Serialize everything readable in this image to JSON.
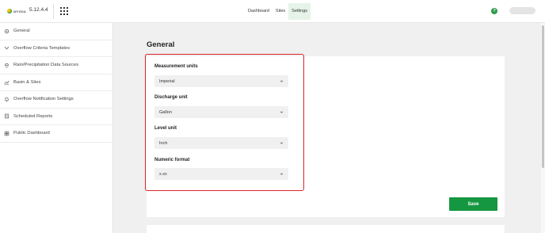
{
  "app": {
    "logo_text": "WYSDA",
    "version": "5.12.4.4"
  },
  "nav": {
    "items": [
      {
        "label": "Dashboard",
        "icon": "",
        "active": false
      },
      {
        "label": "Sites",
        "icon": "",
        "active": false
      },
      {
        "label": "Settings",
        "icon": "",
        "active": true
      }
    ]
  },
  "header": {
    "help_symbol": "?"
  },
  "sidebar": {
    "items": [
      {
        "label": "General",
        "icon": "gear-icon"
      },
      {
        "label": "Overflow Criteria Templates",
        "icon": "chevron-icon"
      },
      {
        "label": "Rain/Precipitation Data Sources",
        "icon": "rain-icon"
      },
      {
        "label": "Basin & Sites",
        "icon": "chart-icon"
      },
      {
        "label": "Overflow Notification Settings",
        "icon": "bell-icon"
      },
      {
        "label": "Scheduled Reports",
        "icon": "report-icon"
      },
      {
        "label": "Public Dashboard",
        "icon": "dashboard-icon"
      }
    ]
  },
  "main": {
    "title": "General",
    "fields": [
      {
        "label": "Measurement units",
        "value": "Imperial"
      },
      {
        "label": "Discharge unit",
        "value": "Gallon"
      },
      {
        "label": "Level unit",
        "value": "Inch"
      },
      {
        "label": "Numeric format",
        "value": "x.xx"
      }
    ],
    "save_label": "Save"
  },
  "colors": {
    "accent": "#159640",
    "highlight": "#d9262c",
    "active_nav_bg": "#e6f3e9"
  }
}
